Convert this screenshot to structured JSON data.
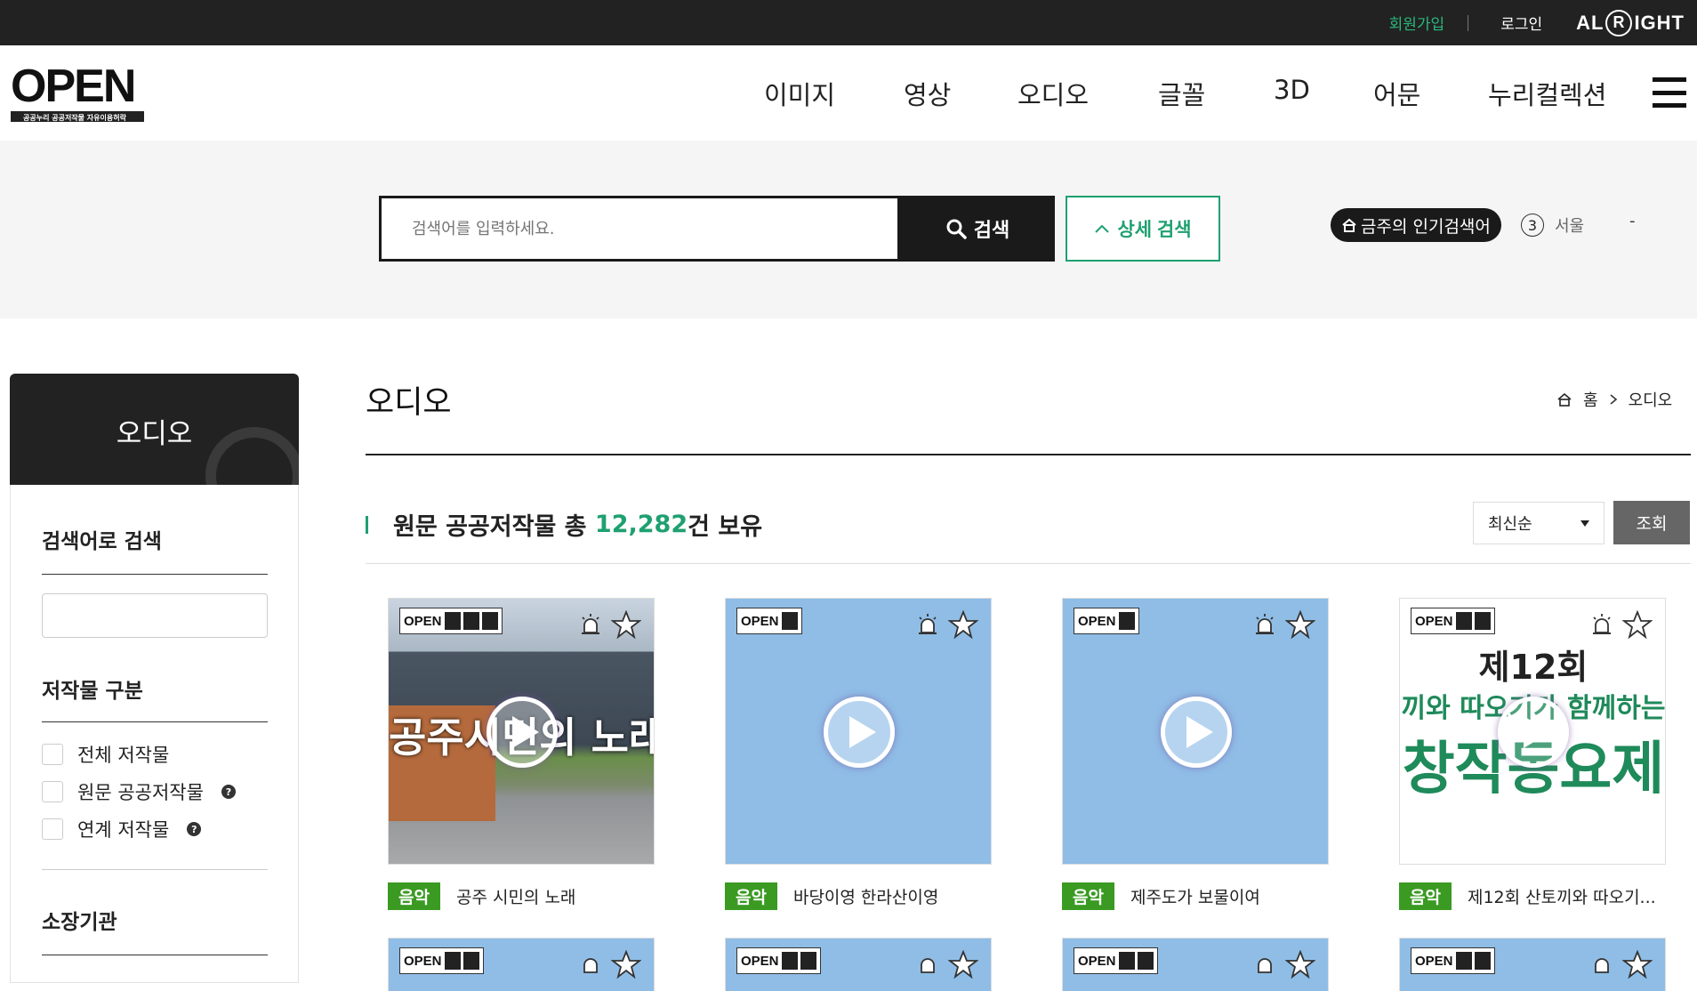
{
  "topbar": {
    "join": "회원가입",
    "login": "로그인",
    "brand_left": "AL",
    "brand_mid": "R",
    "brand_right": "IGHT"
  },
  "header": {
    "logo_text": "OPEN",
    "logo_tagline": "공공누리  공공저작물 자유이용허락",
    "nav": [
      "이미지",
      "영상",
      "오디오",
      "글꼴",
      "3D",
      "어문",
      "누리컬렉션"
    ]
  },
  "search": {
    "placeholder": "검색어를 입력하세요.",
    "button": "검색",
    "detail_button": "상세 검색",
    "popular_label": "금주의 인기검색어",
    "rank_number": "3",
    "rank_word": "서울",
    "rank_change": "-"
  },
  "sidebar": {
    "title": "오디오",
    "keyword_section": "검색어로 검색",
    "type_section": "저작물 구분",
    "type_options": [
      "전체 저작물",
      "원문 공공저작물",
      "연계 저작물"
    ],
    "org_section": "소장기관"
  },
  "content": {
    "page_title": "오디오",
    "breadcrumb_home": "홈",
    "breadcrumb_current": "오디오",
    "count_prefix": "원문 공공저작물 총 ",
    "count_value": "12,282",
    "count_suffix": "건 보유",
    "sort_value": "최신순",
    "view_button": "조회",
    "cards": [
      {
        "tag": "음악",
        "title": "공주 시민의 노래",
        "overlay": "공주시민의 노래"
      },
      {
        "tag": "음악",
        "title": "바당이영 한라산이영",
        "overlay": ""
      },
      {
        "tag": "음악",
        "title": "제주도가 보물이여",
        "overlay": ""
      },
      {
        "tag": "음악",
        "title": "제12회 산토끼와 따오기...",
        "overlay_line1": "제12회",
        "overlay_line2": "끼와 따오기가 함께하는",
        "overlay_line3": "창작동요제"
      }
    ]
  },
  "colors": {
    "accent_green": "#1fa070",
    "tag_green": "#3a9a22",
    "dark": "#222222"
  }
}
